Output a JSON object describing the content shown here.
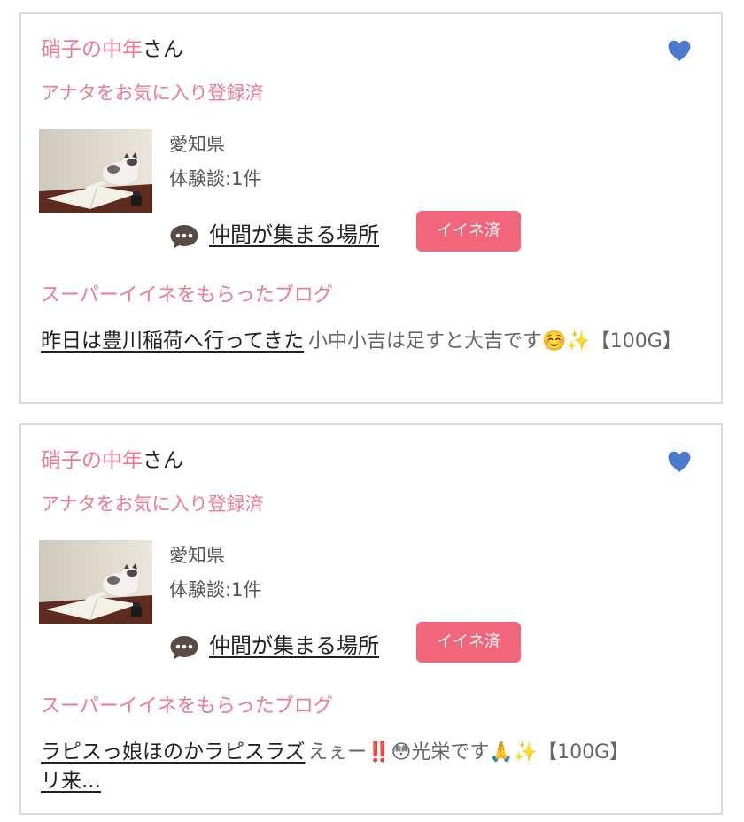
{
  "colors": {
    "accent_pink": "#ec7b90",
    "button_pink": "#f2667c",
    "heart_blue": "#4a7bd0",
    "border": "#d9d9d9"
  },
  "cards": [
    {
      "user_name": "硝子の中年",
      "honorific": "さん",
      "favorite_status": "アナタをお気に入り登録済",
      "favorite_icon": "heart-icon",
      "prefecture": "愛知県",
      "experience_count": "体験談:1件",
      "place_icon": "speech-bubble-icon",
      "place_link": "仲間が集まる場所",
      "iine_button": "イイネ済",
      "super_iine_heading": "スーパーイイネをもらったブログ",
      "blog_title": "昨日は豊川稲荷へ行ってきた",
      "blog_excerpt": "小中小吉は足すと大吉です☺️✨【100G】"
    },
    {
      "user_name": "硝子の中年",
      "honorific": "さん",
      "favorite_status": "アナタをお気に入り登録済",
      "favorite_icon": "heart-icon",
      "prefecture": "愛知県",
      "experience_count": "体験談:1件",
      "place_icon": "speech-bubble-icon",
      "place_link": "仲間が集まる場所",
      "iine_button": "イイネ済",
      "super_iine_heading": "スーパーイイネをもらったブログ",
      "blog_title": "ラピスっ娘ほのかラピスラズリ来...",
      "blog_excerpt": "えぇー‼️😳光栄です🙏✨【100G】"
    }
  ]
}
